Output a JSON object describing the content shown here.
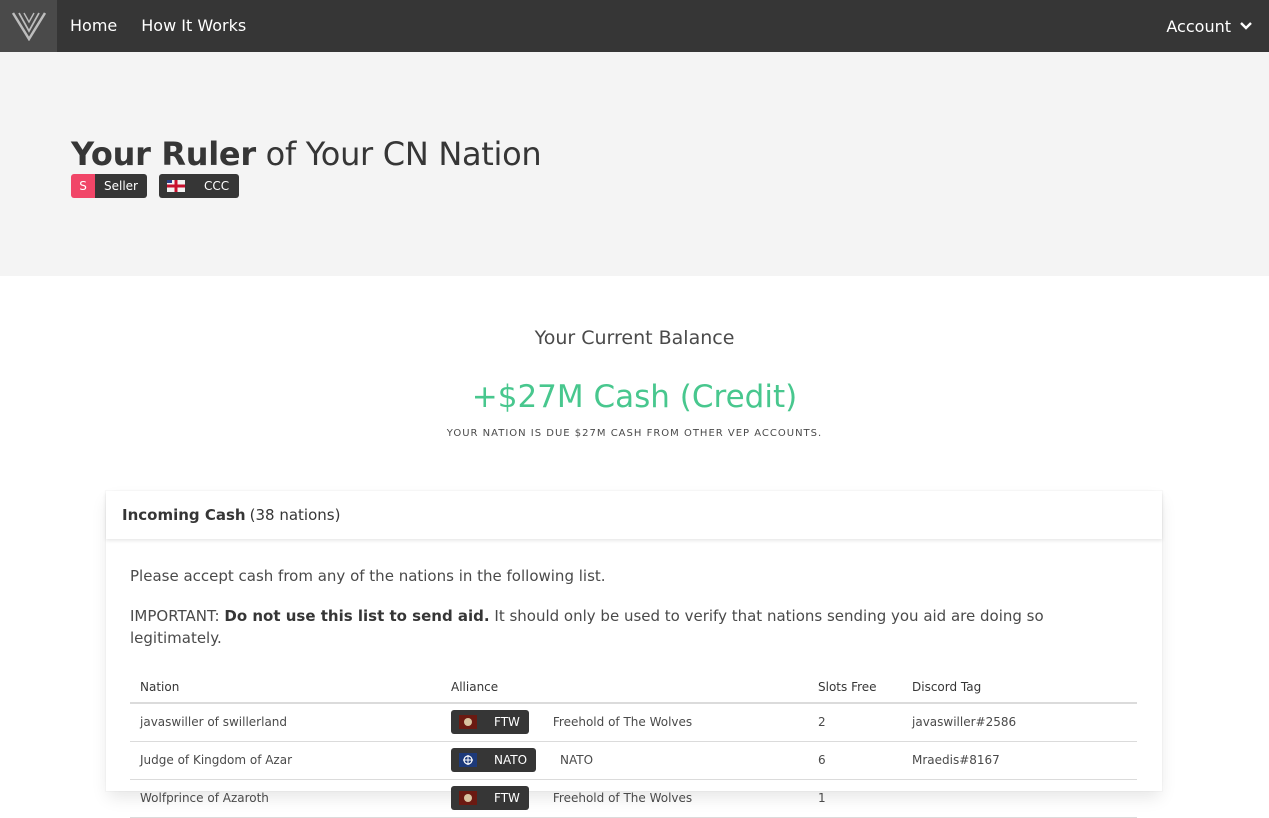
{
  "nav": {
    "logo_icon": "vep-logo-icon",
    "home": "Home",
    "how_it_works": "How It Works",
    "account": "Account"
  },
  "hero": {
    "ruler": "Your Ruler",
    "of_nation": " of Your CN Nation",
    "tags": [
      {
        "prefix": "S",
        "label": "Seller"
      },
      {
        "prefix_icon": "ccc-flag-icon",
        "label": "CCC"
      }
    ]
  },
  "balance": {
    "label": "Your Current Balance",
    "value": "+$27M Cash (Credit)",
    "note": "Your nation is due $27M cash from other VEP accounts."
  },
  "incoming": {
    "title": "Incoming Cash",
    "count": "(38 nations)",
    "intro": "Please accept cash from any of the nations in the following list.",
    "important_prefix": "IMPORTANT: ",
    "important_bold": "Do not use this list to send aid.",
    "important_rest": " It should only be used to verify that nations sending you aid are doing so legitimately.",
    "columns": [
      "Nation",
      "Alliance",
      "Slots Free",
      "Discord Tag"
    ],
    "rows": [
      {
        "nation": "javaswiller of swillerland",
        "alliance_abbr": "FTW",
        "alliance_name": "Freehold of The Wolves",
        "slots": "2",
        "discord": "javaswiller#2586"
      },
      {
        "nation": "Judge of Kingdom of Azar",
        "alliance_abbr": "NATO",
        "alliance_name": "NATO",
        "slots": "6",
        "discord": "Mraedis#8167"
      },
      {
        "nation": "Wolfprince of Azaroth",
        "alliance_abbr": "FTW",
        "alliance_name": "Freehold of The Wolves",
        "slots": "1",
        "discord": ""
      }
    ]
  },
  "colors": {
    "navbar": "#363636",
    "hero_bg": "#f4f4f4",
    "success": "#48c78e",
    "danger": "#f14668"
  }
}
